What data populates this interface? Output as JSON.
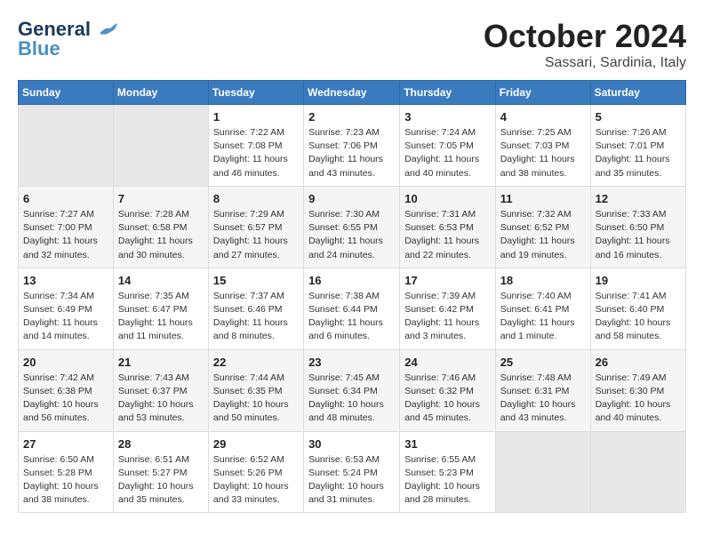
{
  "header": {
    "logo_line1": "General",
    "logo_line2": "Blue",
    "month": "October 2024",
    "location": "Sassari, Sardinia, Italy"
  },
  "weekdays": [
    "Sunday",
    "Monday",
    "Tuesday",
    "Wednesday",
    "Thursday",
    "Friday",
    "Saturday"
  ],
  "weeks": [
    [
      {
        "day": null
      },
      {
        "day": null
      },
      {
        "day": "1",
        "sunrise": "7:22 AM",
        "sunset": "7:08 PM",
        "daylight": "11 hours and 46 minutes."
      },
      {
        "day": "2",
        "sunrise": "7:23 AM",
        "sunset": "7:06 PM",
        "daylight": "11 hours and 43 minutes."
      },
      {
        "day": "3",
        "sunrise": "7:24 AM",
        "sunset": "7:05 PM",
        "daylight": "11 hours and 40 minutes."
      },
      {
        "day": "4",
        "sunrise": "7:25 AM",
        "sunset": "7:03 PM",
        "daylight": "11 hours and 38 minutes."
      },
      {
        "day": "5",
        "sunrise": "7:26 AM",
        "sunset": "7:01 PM",
        "daylight": "11 hours and 35 minutes."
      }
    ],
    [
      {
        "day": "6",
        "sunrise": "7:27 AM",
        "sunset": "7:00 PM",
        "daylight": "11 hours and 32 minutes."
      },
      {
        "day": "7",
        "sunrise": "7:28 AM",
        "sunset": "6:58 PM",
        "daylight": "11 hours and 30 minutes."
      },
      {
        "day": "8",
        "sunrise": "7:29 AM",
        "sunset": "6:57 PM",
        "daylight": "11 hours and 27 minutes."
      },
      {
        "day": "9",
        "sunrise": "7:30 AM",
        "sunset": "6:55 PM",
        "daylight": "11 hours and 24 minutes."
      },
      {
        "day": "10",
        "sunrise": "7:31 AM",
        "sunset": "6:53 PM",
        "daylight": "11 hours and 22 minutes."
      },
      {
        "day": "11",
        "sunrise": "7:32 AM",
        "sunset": "6:52 PM",
        "daylight": "11 hours and 19 minutes."
      },
      {
        "day": "12",
        "sunrise": "7:33 AM",
        "sunset": "6:50 PM",
        "daylight": "11 hours and 16 minutes."
      }
    ],
    [
      {
        "day": "13",
        "sunrise": "7:34 AM",
        "sunset": "6:49 PM",
        "daylight": "11 hours and 14 minutes."
      },
      {
        "day": "14",
        "sunrise": "7:35 AM",
        "sunset": "6:47 PM",
        "daylight": "11 hours and 11 minutes."
      },
      {
        "day": "15",
        "sunrise": "7:37 AM",
        "sunset": "6:46 PM",
        "daylight": "11 hours and 8 minutes."
      },
      {
        "day": "16",
        "sunrise": "7:38 AM",
        "sunset": "6:44 PM",
        "daylight": "11 hours and 6 minutes."
      },
      {
        "day": "17",
        "sunrise": "7:39 AM",
        "sunset": "6:42 PM",
        "daylight": "11 hours and 3 minutes."
      },
      {
        "day": "18",
        "sunrise": "7:40 AM",
        "sunset": "6:41 PM",
        "daylight": "11 hours and 1 minute."
      },
      {
        "day": "19",
        "sunrise": "7:41 AM",
        "sunset": "6:40 PM",
        "daylight": "10 hours and 58 minutes."
      }
    ],
    [
      {
        "day": "20",
        "sunrise": "7:42 AM",
        "sunset": "6:38 PM",
        "daylight": "10 hours and 56 minutes."
      },
      {
        "day": "21",
        "sunrise": "7:43 AM",
        "sunset": "6:37 PM",
        "daylight": "10 hours and 53 minutes."
      },
      {
        "day": "22",
        "sunrise": "7:44 AM",
        "sunset": "6:35 PM",
        "daylight": "10 hours and 50 minutes."
      },
      {
        "day": "23",
        "sunrise": "7:45 AM",
        "sunset": "6:34 PM",
        "daylight": "10 hours and 48 minutes."
      },
      {
        "day": "24",
        "sunrise": "7:46 AM",
        "sunset": "6:32 PM",
        "daylight": "10 hours and 45 minutes."
      },
      {
        "day": "25",
        "sunrise": "7:48 AM",
        "sunset": "6:31 PM",
        "daylight": "10 hours and 43 minutes."
      },
      {
        "day": "26",
        "sunrise": "7:49 AM",
        "sunset": "6:30 PM",
        "daylight": "10 hours and 40 minutes."
      }
    ],
    [
      {
        "day": "27",
        "sunrise": "6:50 AM",
        "sunset": "5:28 PM",
        "daylight": "10 hours and 38 minutes."
      },
      {
        "day": "28",
        "sunrise": "6:51 AM",
        "sunset": "5:27 PM",
        "daylight": "10 hours and 35 minutes."
      },
      {
        "day": "29",
        "sunrise": "6:52 AM",
        "sunset": "5:26 PM",
        "daylight": "10 hours and 33 minutes."
      },
      {
        "day": "30",
        "sunrise": "6:53 AM",
        "sunset": "5:24 PM",
        "daylight": "10 hours and 31 minutes."
      },
      {
        "day": "31",
        "sunrise": "6:55 AM",
        "sunset": "5:23 PM",
        "daylight": "10 hours and 28 minutes."
      },
      {
        "day": null
      },
      {
        "day": null
      }
    ]
  ]
}
